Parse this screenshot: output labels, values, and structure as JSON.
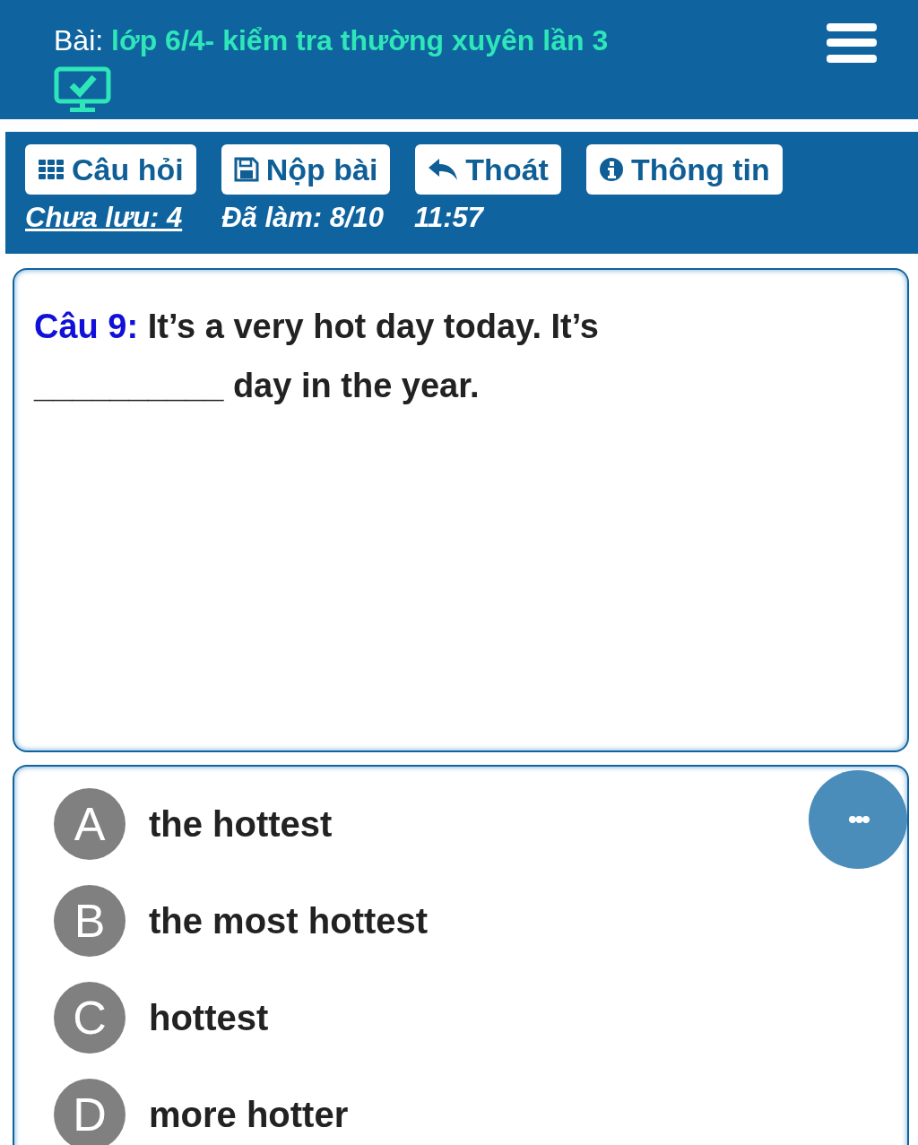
{
  "header": {
    "title_prefix": "Bài:",
    "title": "lớp 6/4- kiểm tra thường xuyên lần 3"
  },
  "toolbar": {
    "buttons": [
      {
        "kind": "grid",
        "label": "Câu hỏi"
      },
      {
        "kind": "save",
        "label": "Nộp bài"
      },
      {
        "kind": "exit",
        "label": "Thoát"
      },
      {
        "kind": "info",
        "label": "Thông tin"
      }
    ]
  },
  "status": {
    "unsaved": "Chưa lưu: 4",
    "done": "Đã làm: 8/10",
    "time": "11:57"
  },
  "question": {
    "label": "Câu 9:",
    "text": "It’s a very hot day today. It’s __________ day in the year."
  },
  "options": [
    {
      "letter": "A",
      "text": "the hottest"
    },
    {
      "letter": "B",
      "text": "the most hottest"
    },
    {
      "letter": "C",
      "text": "hottest"
    },
    {
      "letter": "D",
      "text": "more hotter"
    }
  ],
  "more_button": {
    "label": "•••"
  }
}
